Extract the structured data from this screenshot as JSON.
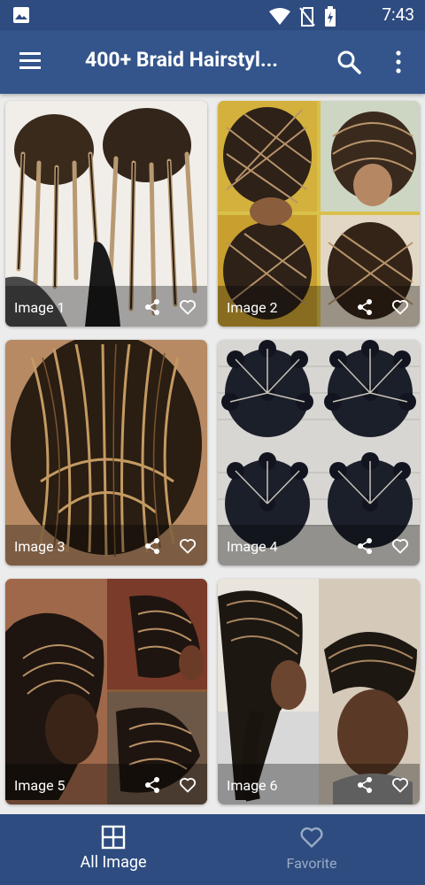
{
  "status_bar": {
    "time": "7:43",
    "icons": [
      "gallery-icon",
      "wifi-icon",
      "no-sim-icon",
      "battery-charging-icon"
    ]
  },
  "app_bar": {
    "title": "400+ Braid Hairstyl...",
    "icons": [
      "menu-icon",
      "search-icon",
      "more-vert-icon"
    ]
  },
  "grid": {
    "items": [
      {
        "label": "Image 1"
      },
      {
        "label": "Image 2"
      },
      {
        "label": "Image 3"
      },
      {
        "label": "Image 4"
      },
      {
        "label": "Image 5"
      },
      {
        "label": "Image 6"
      }
    ]
  },
  "bottom_nav": {
    "items": [
      {
        "label": "All Image",
        "icon": "grid-icon",
        "active": true
      },
      {
        "label": "Favorite",
        "icon": "heart-icon",
        "active": false
      }
    ]
  },
  "colors": {
    "primary": "#34558b",
    "primary_dark": "#2e4c80",
    "inactive_nav": "#9aabc6"
  }
}
